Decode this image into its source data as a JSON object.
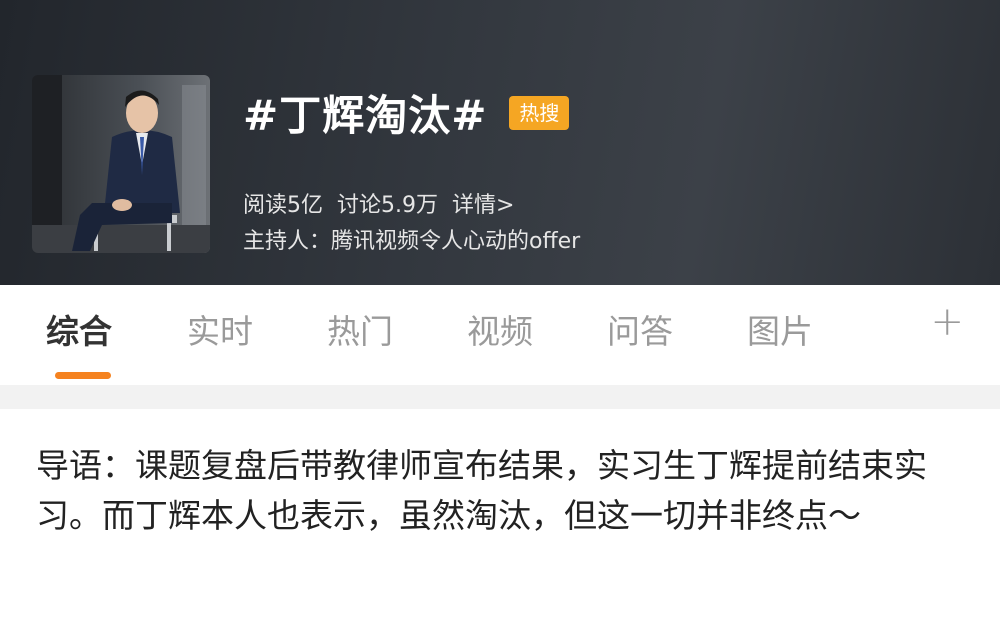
{
  "header": {
    "title": "#丁辉淘汰#",
    "badge": "热搜",
    "reads": "阅读5亿",
    "discussions": "讨论5.9万",
    "details": "详情>",
    "host": "主持人：腾讯视频令人心动的offer"
  },
  "tabs": [
    {
      "label": "综合",
      "active": true
    },
    {
      "label": "实时",
      "active": false
    },
    {
      "label": "热门",
      "active": false
    },
    {
      "label": "视频",
      "active": false
    },
    {
      "label": "问答",
      "active": false
    },
    {
      "label": "图片",
      "active": false
    }
  ],
  "tab_add": "+",
  "intro": "导语：课题复盘后带教律师宣布结果，实习生丁辉提前结束实习。而丁辉本人也表示，虽然淘汰，但这一切并非终点～",
  "colors": {
    "accent": "#f5821f",
    "badge": "#f5a623"
  }
}
